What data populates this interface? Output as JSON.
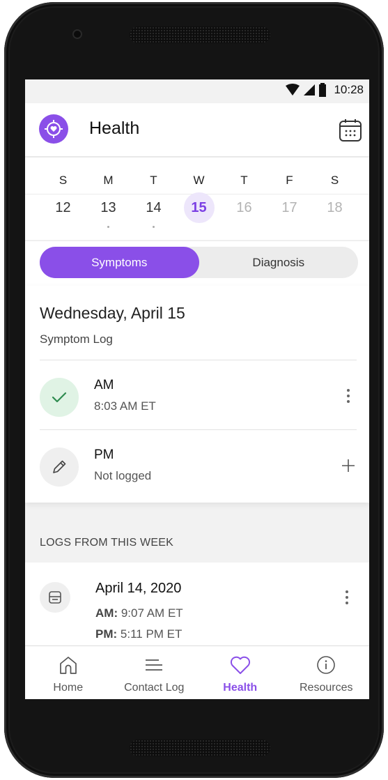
{
  "status_bar": {
    "time": "10:28"
  },
  "header": {
    "title": "Health"
  },
  "week": {
    "day_names": [
      "S",
      "M",
      "T",
      "W",
      "T",
      "F",
      "S"
    ],
    "dates": [
      "12",
      "13",
      "14",
      "15",
      "16",
      "17",
      "18"
    ]
  },
  "tabs": {
    "symptoms": "Symptoms",
    "diagnosis": "Diagnosis"
  },
  "symptom_log": {
    "date": "Wednesday, April 15",
    "subtitle": "Symptom Log",
    "am": {
      "label": "AM",
      "status": "8:03 AM ET"
    },
    "pm": {
      "label": "PM",
      "status": "Not logged"
    }
  },
  "week_logs": {
    "heading": "LOGS FROM THIS WEEK",
    "entries": [
      {
        "date": "April 14, 2020",
        "am_label": "AM:",
        "am_time": "9:07 AM ET",
        "pm_label": "PM:",
        "pm_time": "5:11 PM ET"
      }
    ]
  },
  "nav": {
    "home": "Home",
    "contact_log": "Contact Log",
    "health": "Health",
    "resources": "Resources"
  },
  "colors": {
    "accent": "#8a4fe8",
    "success": "#2e8b4f"
  }
}
